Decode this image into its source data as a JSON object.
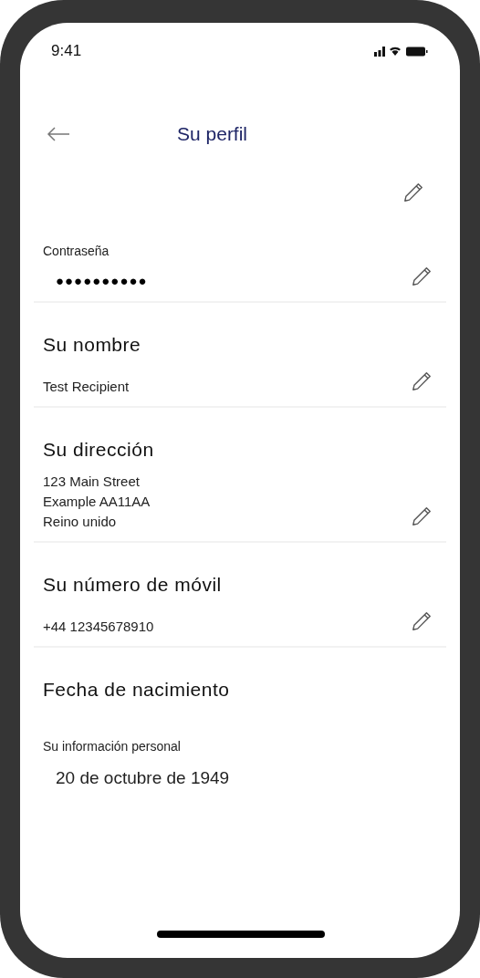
{
  "status_bar": {
    "time": "9:41"
  },
  "header": {
    "title": "Su perfil"
  },
  "sections": [
    {
      "kind": "blank",
      "editable": true
    },
    {
      "kind": "password",
      "label": "Contraseña",
      "value": "●●●●●●●●●●",
      "editable": true
    },
    {
      "kind": "field",
      "heading": "Su nombre",
      "lines": [
        "Test Recipient"
      ],
      "editable": true
    },
    {
      "kind": "field",
      "heading": "Su dirección",
      "lines": [
        "123 Main Street",
        "Example AA11AA",
        "Reino unido"
      ],
      "editable": true
    },
    {
      "kind": "field",
      "heading": "Su número de móvil",
      "lines": [
        "+44 12345678910"
      ],
      "editable": true
    },
    {
      "kind": "info",
      "heading": "Fecha de nacimiento",
      "label": "Su información personal",
      "value": "20 de octubre de 1949",
      "editable": false
    }
  ]
}
